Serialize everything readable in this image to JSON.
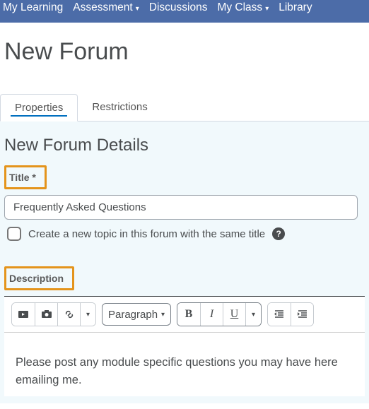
{
  "nav": {
    "my_learning": "My Learning",
    "assessment": "Assessment",
    "discussions": "Discussions",
    "my_class": "My Class",
    "library": "Library"
  },
  "page": {
    "title": "New Forum"
  },
  "tabs": {
    "properties": "Properties",
    "restrictions": "Restrictions"
  },
  "form": {
    "heading": "New Forum Details",
    "title_label": "Title *",
    "title_value": "Frequently Asked Questions",
    "checkbox_label": "Create a new topic in this forum with the same title",
    "description_label": "Description",
    "format_select": "Paragraph",
    "description_body": "Please post any module specific questions you may have here emailing me."
  }
}
